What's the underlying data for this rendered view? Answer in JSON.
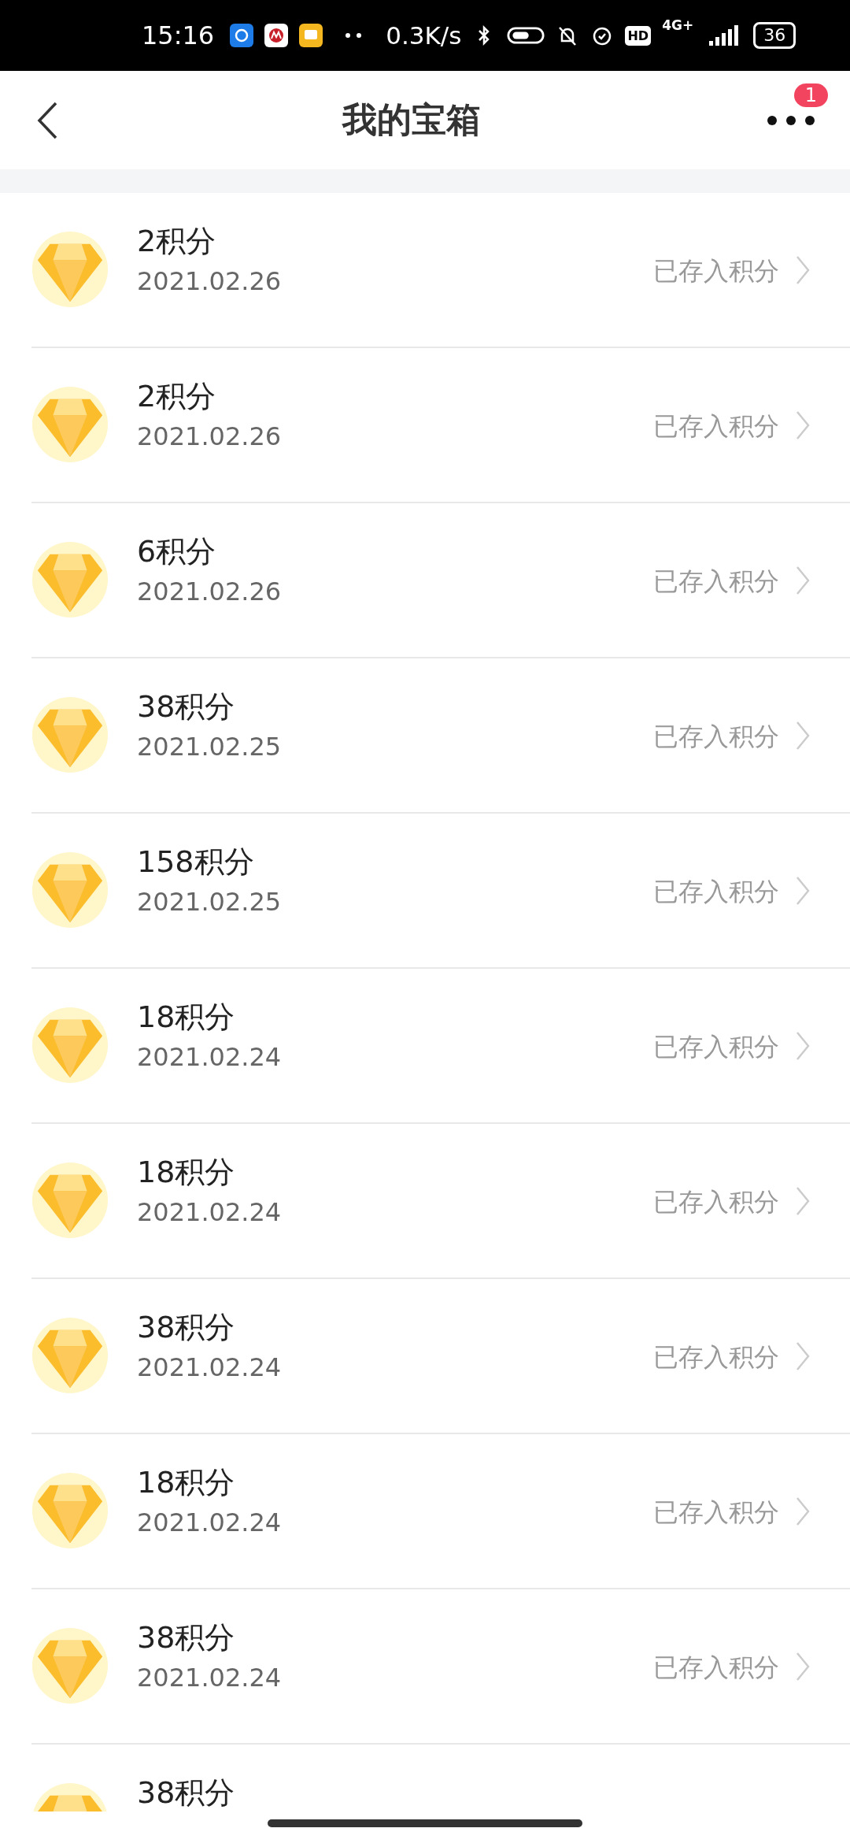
{
  "status_bar": {
    "time": "15:16",
    "speed": "0.3K/s",
    "hd": "HD",
    "network": "4G+",
    "battery": "36"
  },
  "header": {
    "title": "我的宝箱",
    "badge": "1"
  },
  "items": [
    {
      "title": "2积分",
      "date": "2021.02.26",
      "status": "已存入积分"
    },
    {
      "title": "2积分",
      "date": "2021.02.26",
      "status": "已存入积分"
    },
    {
      "title": "6积分",
      "date": "2021.02.26",
      "status": "已存入积分"
    },
    {
      "title": "38积分",
      "date": "2021.02.25",
      "status": "已存入积分"
    },
    {
      "title": "158积分",
      "date": "2021.02.25",
      "status": "已存入积分"
    },
    {
      "title": "18积分",
      "date": "2021.02.24",
      "status": "已存入积分"
    },
    {
      "title": "18积分",
      "date": "2021.02.24",
      "status": "已存入积分"
    },
    {
      "title": "38积分",
      "date": "2021.02.24",
      "status": "已存入积分"
    },
    {
      "title": "18积分",
      "date": "2021.02.24",
      "status": "已存入积分"
    },
    {
      "title": "38积分",
      "date": "2021.02.24",
      "status": "已存入积分"
    },
    {
      "title": "38积分"
    }
  ]
}
